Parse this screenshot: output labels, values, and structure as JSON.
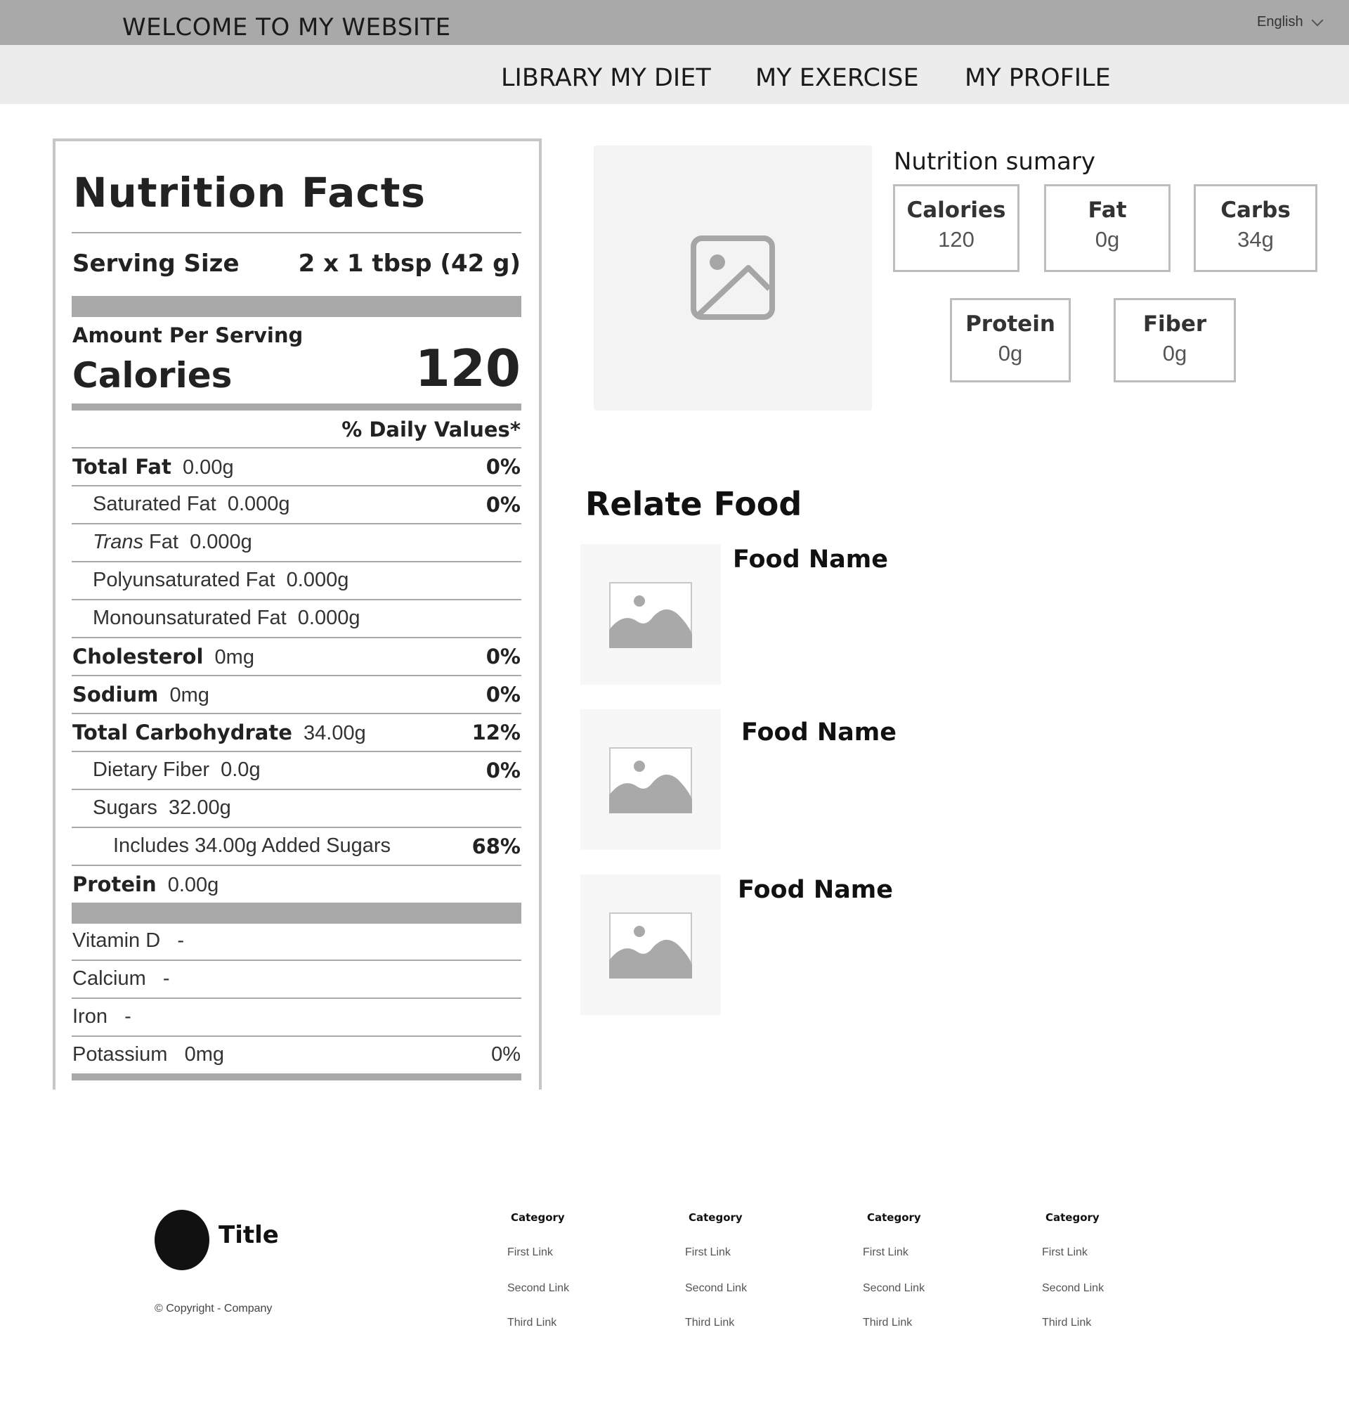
{
  "header": {
    "site_title": "WELCOME TO MY WEBSITE",
    "language": "English"
  },
  "nav": {
    "items": [
      "LIBRARY MY DIET",
      "MY EXERCISE",
      "MY PROFILE"
    ]
  },
  "nutrition_facts": {
    "title": "Nutrition Facts",
    "serving_size_label": "Serving Size",
    "serving_size_value": "2 x 1 tbsp (42 g)",
    "amount_per_serving": "Amount Per Serving",
    "calories_label": "Calories",
    "calories_value": "120",
    "daily_values_header": "% Daily Values*",
    "rows": [
      {
        "label": "Total Fat",
        "amount": "0.00g",
        "dv": "0%"
      },
      {
        "label": "Saturated Fat",
        "amount": "0.000g",
        "dv": "0%"
      },
      {
        "label": "Trans",
        "label2": "Fat",
        "amount": "0.000g",
        "dv": ""
      },
      {
        "label": "Polyunsaturated Fat",
        "amount": "0.000g",
        "dv": ""
      },
      {
        "label": "Monounsaturated Fat",
        "amount": "0.000g",
        "dv": ""
      },
      {
        "label": "Cholesterol",
        "amount": "0mg",
        "dv": "0%"
      },
      {
        "label": "Sodium",
        "amount": "0mg",
        "dv": "0%"
      },
      {
        "label": "Total Carbohydrate",
        "amount": "34.00g",
        "dv": "12%"
      },
      {
        "label": "Dietary Fiber",
        "amount": "0.0g",
        "dv": "0%"
      },
      {
        "label": "Sugars",
        "amount": "32.00g",
        "dv": ""
      },
      {
        "label": "Includes 34.00g Added Sugars",
        "amount": "",
        "dv": "68%"
      },
      {
        "label": "Protein",
        "amount": "0.00g",
        "dv": ""
      }
    ],
    "vitamins": [
      {
        "label": "Vitamin D",
        "amount": "-",
        "dv": ""
      },
      {
        "label": "Calcium",
        "amount": "-",
        "dv": ""
      },
      {
        "label": "Iron",
        "amount": "-",
        "dv": ""
      },
      {
        "label": "Potassium",
        "amount": "0mg",
        "dv": "0%"
      }
    ]
  },
  "summary": {
    "title": "Nutrition sumary",
    "boxes": [
      {
        "label": "Calories",
        "value": "120"
      },
      {
        "label": "Fat",
        "value": "0g"
      },
      {
        "label": "Carbs",
        "value": "34g"
      },
      {
        "label": "Protein",
        "value": "0g"
      },
      {
        "label": "Fiber",
        "value": "0g"
      }
    ]
  },
  "related": {
    "title": "Relate Food",
    "items": [
      "Food Name",
      "Food Name",
      "Food Name"
    ]
  },
  "footer": {
    "title": "Title",
    "copyright": "© Copyright - Company",
    "columns": [
      {
        "category": "Category",
        "links": [
          "First Link",
          "Second Link",
          "Third Link"
        ]
      },
      {
        "category": "Category",
        "links": [
          "First Link",
          "Second Link",
          "Third Link"
        ]
      },
      {
        "category": "Category",
        "links": [
          "First Link",
          "Second Link",
          "Third Link"
        ]
      },
      {
        "category": "Category",
        "links": [
          "First Link",
          "Second Link",
          "Third Link"
        ]
      }
    ]
  },
  "colors": {
    "topbar": "#a9a9a9",
    "navbar": "#ececec",
    "rule": "#a9a9a9",
    "placeholder": "#f3f3f3"
  }
}
